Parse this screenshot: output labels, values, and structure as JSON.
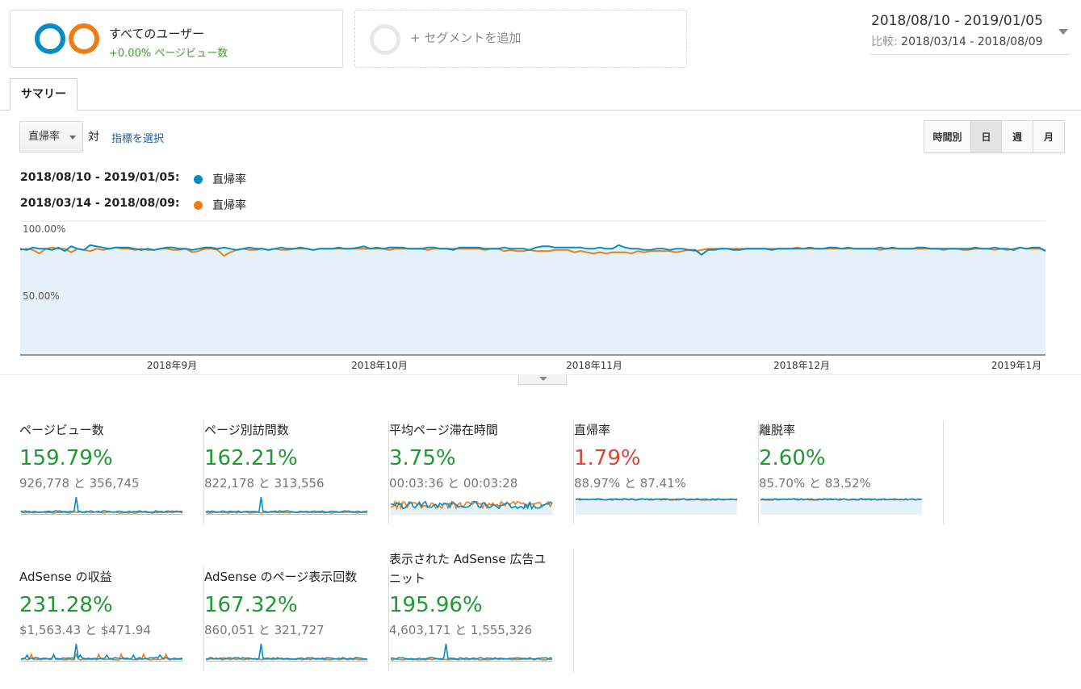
{
  "segments": {
    "all_users": {
      "title": "すべてのユーザー",
      "subtitle": "+0.00% ページビュー数"
    },
    "add": {
      "label": "+ セグメントを追加"
    }
  },
  "date_range": {
    "main": "2018/08/10 - 2019/01/05",
    "compare_label": "比較:",
    "compare": "2018/03/14 - 2018/08/09"
  },
  "tabs": [
    {
      "label": "サマリー"
    }
  ],
  "controls": {
    "metric": "直帰率",
    "vs": "対",
    "pick_metric": "指標を選択",
    "granularity": [
      "時間別",
      "日",
      "週",
      "月"
    ],
    "granularity_selected": "日"
  },
  "legend": [
    {
      "range": "2018/08/10 - 2019/01/05:",
      "metric": "直帰率",
      "color": "#058dc7"
    },
    {
      "range": "2018/03/14 - 2018/08/09:",
      "metric": "直帰率",
      "color": "#ed7e17"
    }
  ],
  "chart_data": {
    "type": "line",
    "y_tick_labels": [
      "100.00%",
      "50.00%"
    ],
    "ylim": [
      0,
      100
    ],
    "x_tick_labels": [
      "2018年9月",
      "2018年10月",
      "2018年11月",
      "2018年12月",
      "2019年1月"
    ],
    "fill": "area under first series",
    "series": [
      {
        "color": "#058dc7",
        "values": [
          89,
          88,
          90,
          89,
          89,
          88,
          90,
          87,
          91,
          89,
          88,
          92,
          91,
          90,
          89,
          90,
          90,
          90,
          89,
          88,
          89,
          88,
          89,
          90,
          90,
          89,
          89,
          88,
          89,
          90,
          90,
          89,
          90,
          89,
          88,
          89,
          90,
          89,
          89,
          88,
          89,
          90,
          89,
          89,
          90,
          89,
          88,
          89,
          89,
          89,
          90,
          89,
          89,
          90,
          91,
          89,
          90,
          89,
          90,
          90,
          90,
          89,
          89,
          89,
          90,
          90,
          89,
          89,
          88,
          90,
          90,
          90,
          90,
          89,
          89,
          89,
          90,
          89,
          89,
          89,
          88,
          90,
          91,
          91,
          90,
          90,
          90,
          90,
          90,
          89,
          89,
          90,
          89,
          89,
          92,
          90,
          89,
          89,
          88,
          88,
          89,
          89,
          88,
          89,
          89,
          88,
          88,
          84,
          88,
          88,
          89,
          89,
          88,
          88,
          89,
          89,
          89,
          89,
          88,
          89,
          89,
          89,
          89,
          89,
          90,
          89,
          89,
          90,
          90,
          89,
          90,
          89,
          89,
          89,
          89,
          90,
          89,
          90,
          89,
          89,
          89,
          90,
          90,
          89,
          89,
          89,
          89,
          89,
          89,
          89,
          90,
          89,
          89,
          90,
          89,
          89,
          88,
          90,
          89,
          90,
          90,
          87
        ]
      },
      {
        "color": "#ed7e17",
        "values": [
          88,
          89,
          88,
          85,
          89,
          90,
          89,
          89,
          86,
          89,
          88,
          87,
          89,
          88,
          89,
          90,
          89,
          89,
          88,
          89,
          88,
          88,
          89,
          89,
          88,
          88,
          89,
          86,
          87,
          89,
          89,
          88,
          83,
          86,
          88,
          89,
          88,
          88,
          89,
          88,
          89,
          88,
          88,
          89,
          89,
          89,
          88,
          89,
          89,
          89,
          89,
          89,
          89,
          89,
          89,
          89,
          89,
          89,
          88,
          89,
          89,
          89,
          89,
          89,
          88,
          89,
          89,
          89,
          89,
          89,
          89,
          89,
          89,
          88,
          89,
          89,
          87,
          88,
          87,
          87,
          88,
          87,
          87,
          87,
          88,
          88,
          88,
          86,
          87,
          86,
          85,
          86,
          85,
          86,
          86,
          86,
          85,
          87,
          86,
          87,
          87,
          87,
          87,
          86,
          87,
          88,
          87,
          88,
          89,
          89,
          89,
          89,
          89,
          89,
          89,
          89,
          89,
          89,
          89,
          89,
          89,
          89,
          90,
          89,
          89,
          89,
          89,
          89,
          89,
          89,
          89,
          89,
          89,
          89,
          89,
          88,
          89,
          89,
          89,
          89,
          89,
          89,
          89,
          89,
          89,
          88,
          89,
          89,
          88,
          88,
          89,
          89,
          89,
          88,
          89,
          88,
          89,
          90,
          89,
          89,
          89,
          88
        ]
      }
    ]
  },
  "scorecards": [
    {
      "title": "ページビュー数",
      "change": "159.79%",
      "compare": "926,778 と 356,745",
      "trend": "up",
      "spark": "pv"
    },
    {
      "title": "ページ別訪問数",
      "change": "162.21%",
      "compare": "822,178 と 313,556",
      "trend": "up",
      "spark": "pv"
    },
    {
      "title": "平均ページ滞在時間",
      "change": "3.75%",
      "compare": "00:03:36 と 00:03:28",
      "trend": "up",
      "spark": "noisy"
    },
    {
      "title": "直帰率",
      "change": "1.79%",
      "compare": "88.97% と 87.41%",
      "trend": "down",
      "spark": "flat"
    },
    {
      "title": "離脱率",
      "change": "2.60%",
      "compare": "85.70% と 83.52%",
      "trend": "up",
      "spark": "flat"
    },
    {
      "title": "AdSense の収益",
      "change": "231.28%",
      "compare": "$1,563.43 と $471.94",
      "trend": "up",
      "spark": "ads"
    },
    {
      "title": "AdSense のページ表示回数",
      "change": "167.32%",
      "compare": "860,051 と 321,727",
      "trend": "up",
      "spark": "pv"
    },
    {
      "title": "表示された AdSense 広告ユニット",
      "change": "195.96%",
      "compare": "4,603,171 と 1,555,326",
      "trend": "up",
      "spark": "pv"
    }
  ],
  "colors": {
    "primary": "#058dc7",
    "compare": "#ed7e17",
    "positive": "#1e9a32",
    "negative": "#db4437"
  }
}
